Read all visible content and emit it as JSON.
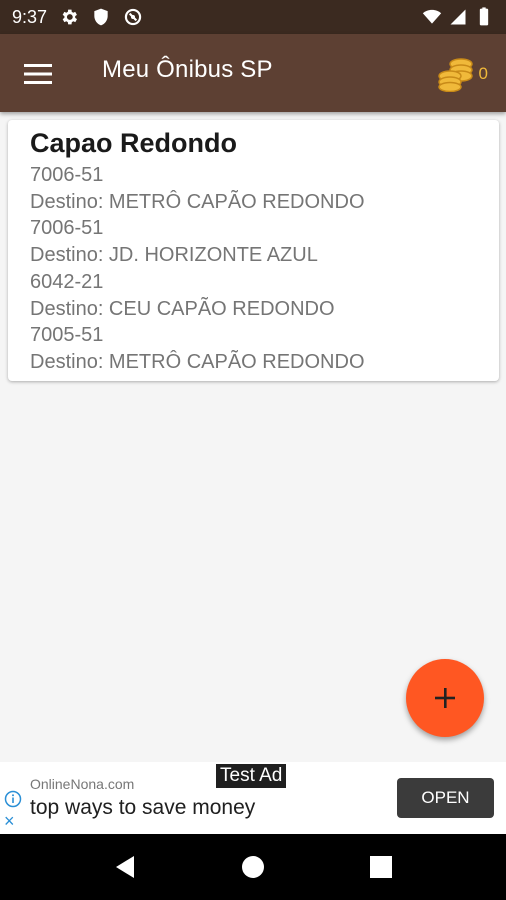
{
  "status_bar": {
    "time": "9:37",
    "icons": [
      "gear-icon",
      "shield-icon",
      "circle-slash-icon",
      "wifi-icon",
      "signal-icon",
      "battery-icon"
    ]
  },
  "app_bar": {
    "title": "Meu Ônibus SP",
    "menu_icon": "hamburger-menu-icon",
    "coin_icon": "coins-icon",
    "coin_count": "0"
  },
  "card": {
    "title": "Capao Redondo",
    "lines": [
      {
        "code": "7006-51",
        "destination": "Destino: METRÔ CAPÃO REDONDO"
      },
      {
        "code": "7006-51",
        "destination": "Destino: JD. HORIZONTE AZUL"
      },
      {
        "code": "6042-21",
        "destination": "Destino: CEU CAPÃO REDONDO"
      },
      {
        "code": "7005-51",
        "destination": "Destino: METRÔ CAPÃO REDONDO"
      }
    ]
  },
  "fab": {
    "icon": "plus-icon"
  },
  "ad": {
    "label": "Test Ad",
    "url": "OnlineNona.com",
    "headline": "top ways to save money",
    "button_label": "OPEN",
    "close_glyph": "×"
  },
  "navigation_bar": {
    "icons": [
      "back-icon",
      "home-icon",
      "recents-icon"
    ]
  },
  "colors": {
    "status_bar": "#3b2a20",
    "app_bar": "#5d4033",
    "fab": "#ff5722",
    "coins": "#f0b93a",
    "background": "#f5f5f5"
  }
}
